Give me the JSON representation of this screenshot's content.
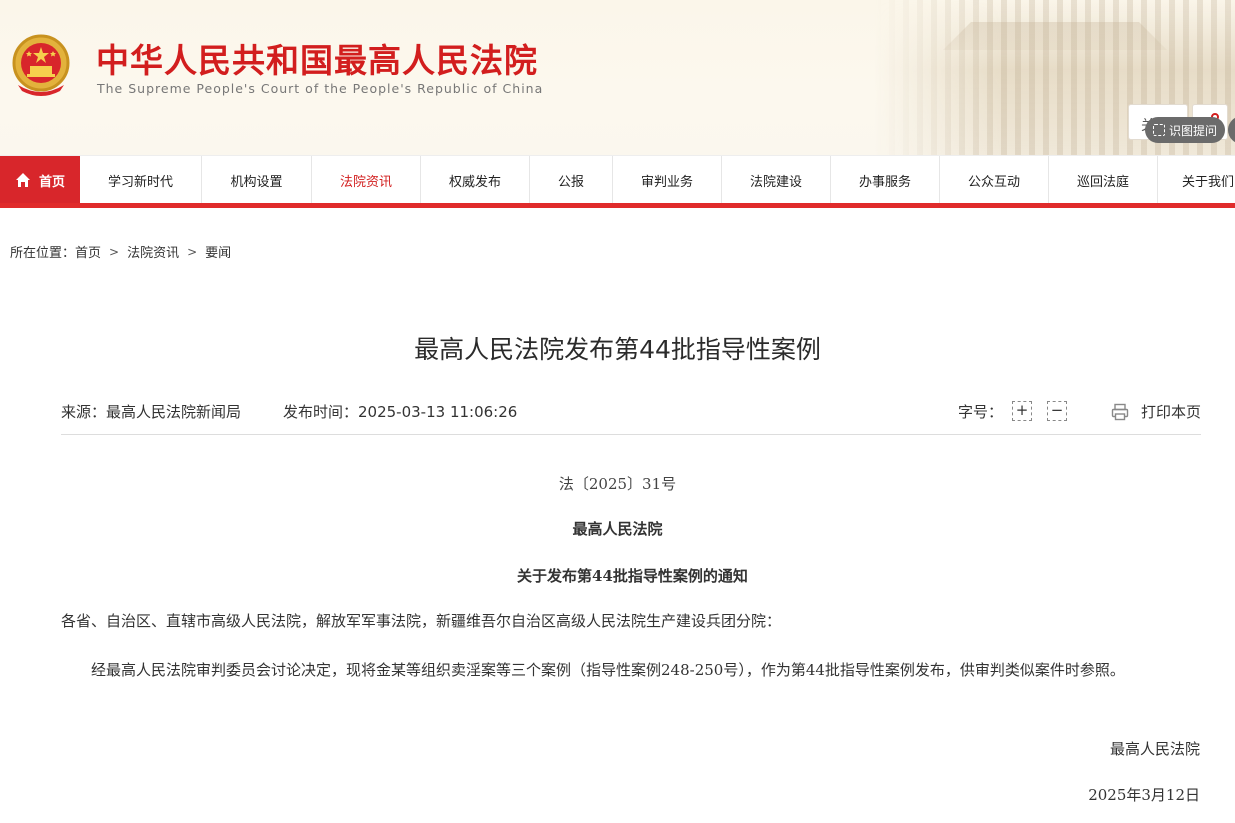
{
  "site": {
    "title": "中华人民共和国最高人民法院",
    "subtitle": "The Supreme People's Court of the People's Republic of China",
    "header_button_partial": "关",
    "ocr_button": "识图提问"
  },
  "nav": {
    "items": [
      {
        "label": "首页"
      },
      {
        "label": "学习新时代"
      },
      {
        "label": "机构设置"
      },
      {
        "label": "法院资讯"
      },
      {
        "label": "权威发布"
      },
      {
        "label": "公报"
      },
      {
        "label": "审判业务"
      },
      {
        "label": "法院建设"
      },
      {
        "label": "办事服务"
      },
      {
        "label": "公众互动"
      },
      {
        "label": "巡回法庭"
      },
      {
        "label": "关于我们"
      }
    ],
    "active_index": 3
  },
  "breadcrumb": {
    "prefix": "所在位置：",
    "items": [
      "首页",
      "法院资讯",
      "要闻"
    ]
  },
  "article": {
    "title": "最高人民法院发布第44批指导性案例",
    "source": "来源：最高人民法院新闻局",
    "pubtime": "发布时间：2025-03-13 11:06:26",
    "font_size_label": "字号：",
    "font_increase": "+",
    "font_decrease": "−",
    "print_label": "打印本页",
    "doc_no": "法〔2025〕31号",
    "issuer": "最高人民法院",
    "notice_title": "关于发布第44批指导性案例的通知",
    "salutation": "各省、自治区、直辖市高级人民法院，解放军军事法院，新疆维吾尔自治区高级人民法院生产建设兵团分院：",
    "body": "经最高人民法院审判委员会讨论决定，现将金某等组织卖淫案等三个案例（指导性案例248-250号），作为第44批指导性案例发布，供审判类似案件时参照。",
    "sign": "最高人民法院",
    "date": "2025年3月12日"
  },
  "colors": {
    "brand_red": "#d21e1e",
    "nav_home_bg": "#d8262b",
    "nav_underline": "#e02b2b"
  }
}
